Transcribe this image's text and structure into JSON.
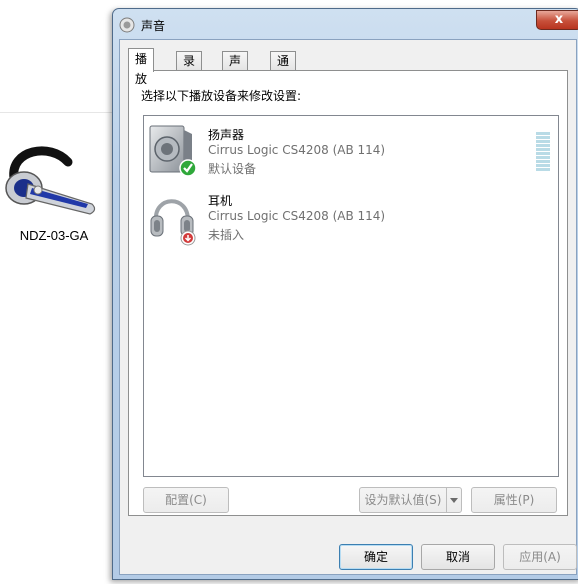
{
  "desktop": {
    "icon_name": "headset-icon",
    "icon_label": "NDZ-03-GA"
  },
  "dialog": {
    "title": "声音",
    "title_icon": "speaker-icon",
    "close_glyph": "x"
  },
  "tabs": [
    {
      "label": "播放",
      "active": true
    },
    {
      "label": "录制",
      "active": false
    },
    {
      "label": "声音",
      "active": false
    },
    {
      "label": "通信",
      "active": false
    }
  ],
  "playback": {
    "instruction": "选择以下播放设备来修改设置:",
    "devices": [
      {
        "name": "扬声器",
        "description": "Cirrus Logic CS4208 (AB 114)",
        "status": "默认设备",
        "icon": "speaker-device-icon",
        "badge": "green-check-icon"
      },
      {
        "name": "耳机",
        "description": "Cirrus Logic CS4208 (AB 114)",
        "status": "未插入",
        "icon": "headphones-device-icon",
        "badge": "red-down-arrow-icon"
      }
    ]
  },
  "buttons": {
    "configure": "配置(C)",
    "set_default": "设为默认值(S)",
    "properties": "属性(P)",
    "ok": "确定",
    "cancel": "取消",
    "apply": "应用(A)"
  },
  "colors": {
    "check_green": "#2fa83a",
    "unplugged_red": "#d23b3b",
    "meter_blue": "#b9dbe6"
  }
}
